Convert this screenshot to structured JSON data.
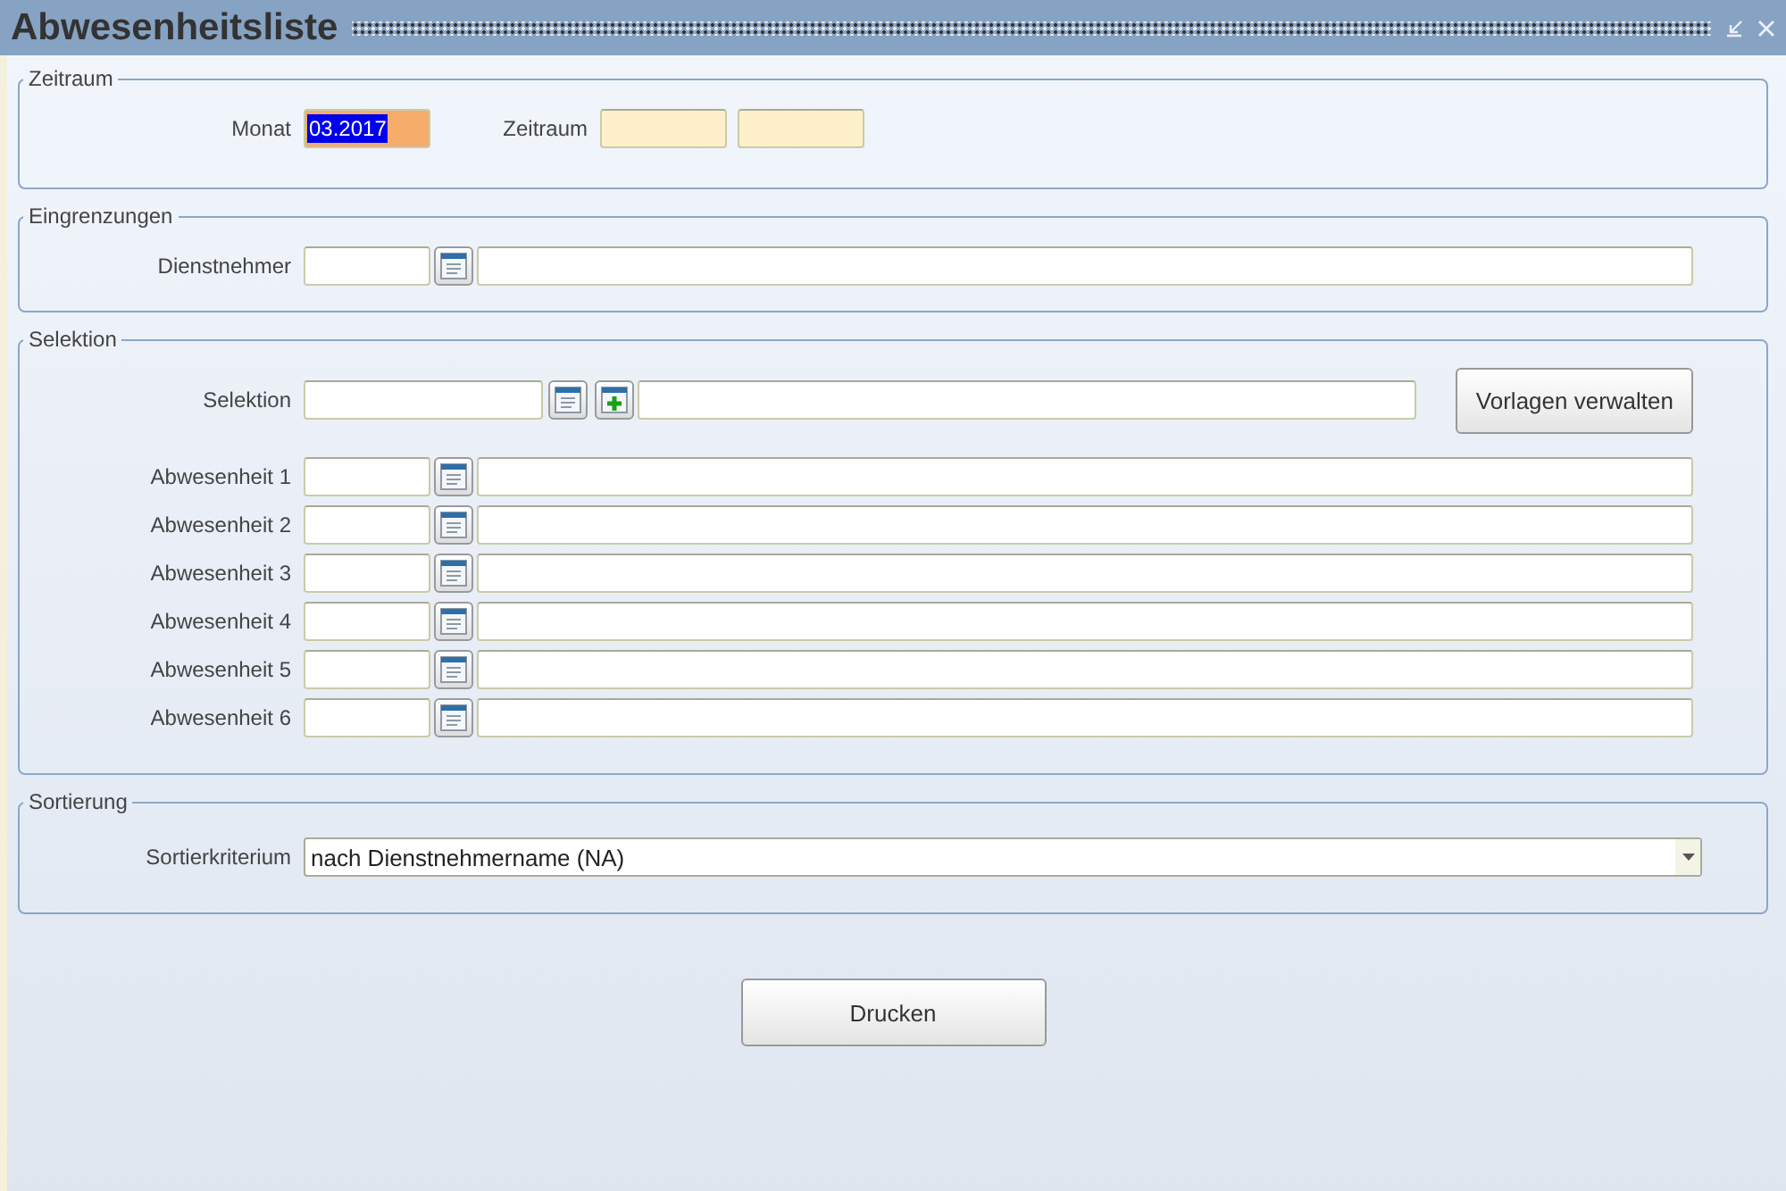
{
  "window": {
    "title": "Abwesenheitsliste"
  },
  "zeitraum": {
    "legend": "Zeitraum",
    "month_label": "Monat",
    "month_value": "03.2017",
    "month_focused": true,
    "range_label": "Zeitraum"
  },
  "eingrenzungen": {
    "legend": "Eingrenzungen",
    "rows": [
      {
        "label": "Dienstnehmer"
      }
    ]
  },
  "selektion": {
    "legend": "Selektion",
    "selection_label": "Selektion",
    "manage_button": "Vorlagen verwalten",
    "rows": [
      {
        "label": "Abwesenheit 1"
      },
      {
        "label": "Abwesenheit 2"
      },
      {
        "label": "Abwesenheit 3"
      },
      {
        "label": "Abwesenheit 4"
      },
      {
        "label": "Abwesenheit 5"
      },
      {
        "label": "Abwesenheit 6"
      }
    ]
  },
  "sortierung": {
    "legend": "Sortierung",
    "label": "Sortierkriterium",
    "value": "nach Dienstnehmername (NA)"
  },
  "print_button": "Drucken"
}
